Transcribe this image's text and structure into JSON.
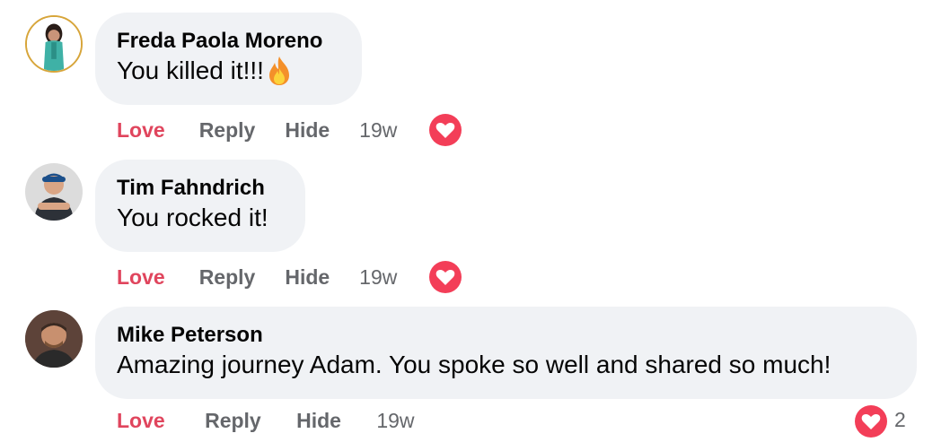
{
  "comments": [
    {
      "author": "Freda Paola Moreno",
      "text": "You killed it!!!",
      "emoji": "fire-emoji",
      "actions": {
        "love": "Love",
        "reply": "Reply",
        "hide": "Hide",
        "time": "19w"
      },
      "reaction": "heart-icon"
    },
    {
      "author": "Tim Fahndrich",
      "text": "You rocked it!",
      "actions": {
        "love": "Love",
        "reply": "Reply",
        "hide": "Hide",
        "time": "19w"
      },
      "reaction": "heart-icon"
    },
    {
      "author": "Mike Peterson",
      "text": "Amazing journey Adam. You spoke so well and shared so much!",
      "actions": {
        "love": "Love",
        "reply": "Reply",
        "hide": "Hide",
        "time": "19w"
      },
      "reaction": "heart-icon",
      "reaction_count": "2"
    }
  ],
  "colors": {
    "bubble": "#f0f2f5",
    "love_action": "#e0455d",
    "muted_text": "#65676b",
    "heart": "#f33e58"
  }
}
